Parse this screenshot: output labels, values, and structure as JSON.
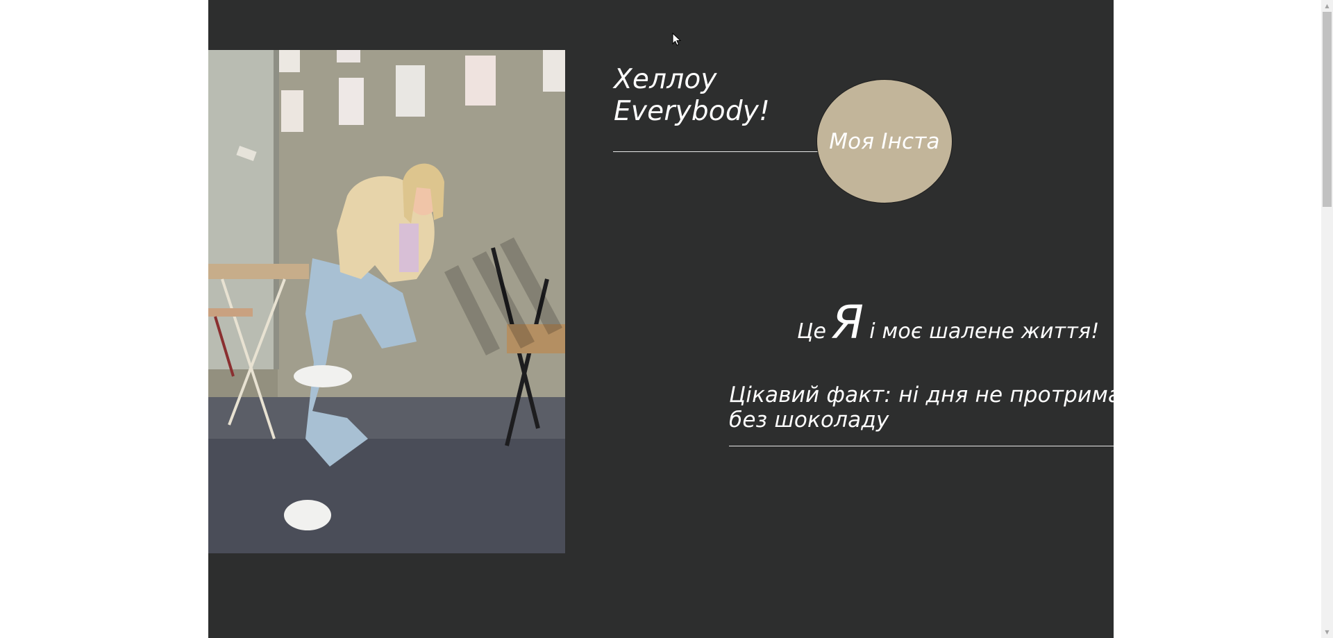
{
  "hero": {
    "greeting_line1": "Хеллоу",
    "greeting_line2": "Everybody!",
    "insta_label": "Моя Інста",
    "tagline_before": "Це",
    "tagline_big": "Я",
    "tagline_after": "і моє шалене життя!",
    "fact_line1": "Цікавий факт: ні дня не протрималась",
    "fact_line2": "без шоколаду"
  },
  "colors": {
    "page_background": "#2d2e2e",
    "outer_background": "#ffffff",
    "insta_circle": "#c2b59a",
    "text": "#ffffff",
    "divider": "#e9e9e9"
  },
  "icons": {
    "cursor": "mouse-pointer-icon",
    "scroll_up": "scroll-up-arrow-icon",
    "scroll_down": "scroll-down-arrow-icon"
  }
}
